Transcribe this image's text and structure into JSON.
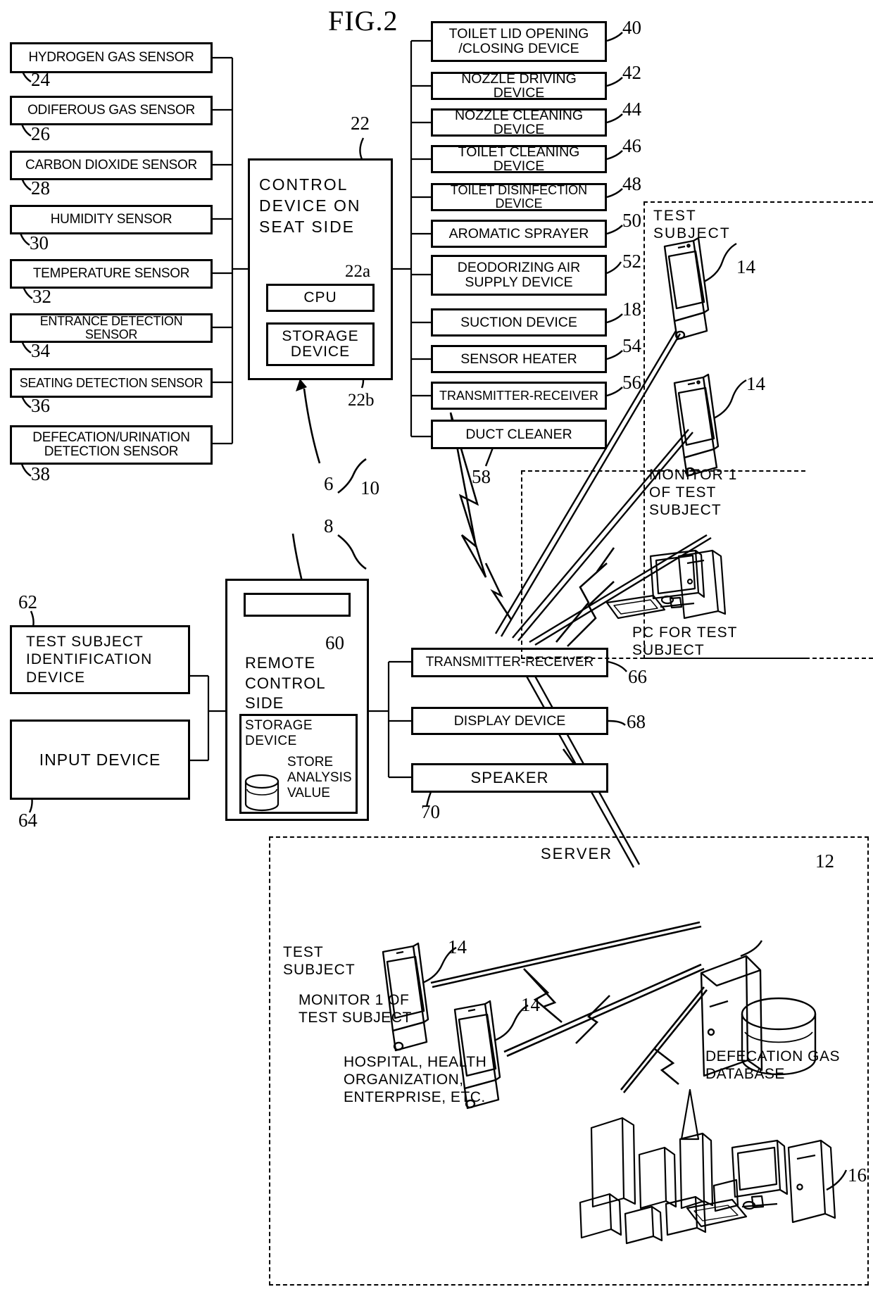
{
  "figure": {
    "title": "FIG.2"
  },
  "sensors": [
    {
      "label": "HYDROGEN GAS SENSOR",
      "num": "24"
    },
    {
      "label": "ODIFEROUS GAS SENSOR",
      "num": "26"
    },
    {
      "label": "CARBON DIOXIDE SENSOR",
      "num": "28"
    },
    {
      "label": "HUMIDITY SENSOR",
      "num": "30"
    },
    {
      "label": "TEMPERATURE SENSOR",
      "num": "32"
    },
    {
      "label": "ENTRANCE DETECTION SENSOR",
      "num": "34"
    },
    {
      "label": "SEATING DETECTION SENSOR",
      "num": "36"
    },
    {
      "label": "DEFECATION/URINATION\nDETECTION SENSOR",
      "num": "38"
    }
  ],
  "control_device": {
    "title": "CONTROL\nDEVICE  ON\nSEAT SIDE",
    "num": "22",
    "cpu": {
      "label": "CPU",
      "num": "22a"
    },
    "storage": {
      "label": "STORAGE\nDEVICE",
      "num": "22b"
    }
  },
  "devices": [
    {
      "label": "TOILET LID OPENING\n/CLOSING DEVICE",
      "num": "40"
    },
    {
      "label": "NOZZLE DRIVING DEVICE",
      "num": "42"
    },
    {
      "label": "NOZZLE CLEANING DEVICE",
      "num": "44"
    },
    {
      "label": "TOILET CLEANING DEVICE",
      "num": "46"
    },
    {
      "label": "TOILET DISINFECTION DEVICE",
      "num": "48"
    },
    {
      "label": "AROMATIC SPRAYER",
      "num": "50"
    },
    {
      "label": "DEODORIZING AIR\nSUPPLY DEVICE",
      "num": "52"
    },
    {
      "label": "SUCTION DEVICE",
      "num": "18"
    },
    {
      "label": "SENSOR HEATER",
      "num": "54"
    },
    {
      "label": "TRANSMITTER-RECEIVER",
      "num": "56"
    },
    {
      "label": "DUCT CLEANER",
      "num": "58"
    }
  ],
  "system_nums": {
    "six": "6",
    "eight": "8",
    "ten": "10"
  },
  "remote": {
    "title": "REMOTE\nCONTROL\nSIDE",
    "display_num": "60",
    "storage": {
      "title": "STORAGE\nDEVICE",
      "db_label": "STORE\nANALYSIS\nVALUE"
    }
  },
  "left_inputs": [
    {
      "label": "TEST SUBJECT\nIDENTIFICATION\nDEVICE",
      "num": "62"
    },
    {
      "label": "INPUT DEVICE",
      "num": "64"
    }
  ],
  "remote_outputs": [
    {
      "label": "TRANSMITTER-RECEIVER",
      "num": "66"
    },
    {
      "label": "DISPLAY DEVICE",
      "num": "68"
    },
    {
      "label": "SPEAKER",
      "num": "70"
    }
  ],
  "test_subject_panel": {
    "title": "TEST\nSUBJECT",
    "phone_num_1": "14",
    "phone_num_2": "14",
    "monitor_caption": "MONITOR 1\nOF TEST\nSUBJECT",
    "pc_caption": "PC FOR TEST\nSUBJECT"
  },
  "server_panel": {
    "server_label": "SERVER",
    "server_num": "12",
    "database_label": "DEFECATION GAS\nDATABASE",
    "test_subject_caption": "TEST\nSUBJECT",
    "monitor_caption": "MONITOR 1  OF\nTEST  SUBJECT",
    "org_caption": "HOSPITAL, HEALTH\nORGANIZATION,\nENTERPRISE, ETC.",
    "phone_num_1": "14",
    "phone_num_2": "14",
    "org_num": "16"
  },
  "colors": {
    "ink": "#000000",
    "paper": "#ffffff"
  }
}
